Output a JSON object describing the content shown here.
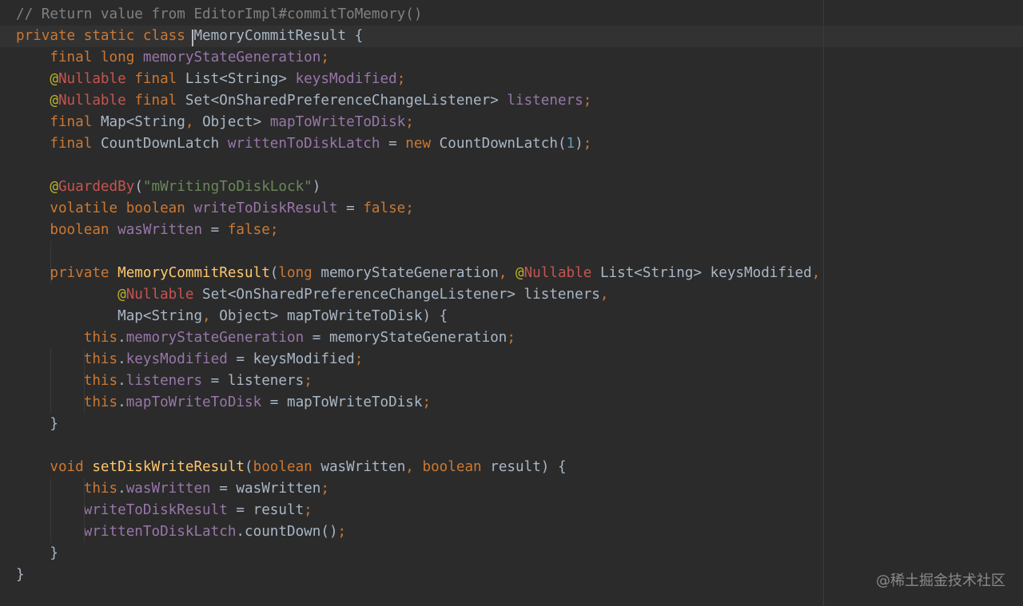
{
  "editor": {
    "language": "Java",
    "theme_colors": {
      "background": "#2b2b2b",
      "keyword": "#cc7832",
      "field": "#9876aa",
      "method": "#ffc66d",
      "string": "#6a8759",
      "number": "#6897bb",
      "comment": "#808080",
      "nullable_annotation": "#c75450",
      "plain": "#a9b7c6"
    },
    "current_line_index": 1,
    "lines": [
      [
        [
          "comment",
          "// Return value from EditorImpl#commitToMemory()"
        ]
      ],
      [
        [
          "kw",
          "private static class "
        ],
        [
          "plain",
          "MemoryCommitResult {"
        ]
      ],
      [
        [
          "plain",
          "    "
        ],
        [
          "kw",
          "final long "
        ],
        [
          "field",
          "memoryStateGeneration"
        ],
        [
          "punc",
          ";"
        ]
      ],
      [
        [
          "plain",
          "    "
        ],
        [
          "anno",
          "@"
        ],
        [
          "anno-nullable",
          "Nullable "
        ],
        [
          "kw",
          "final "
        ],
        [
          "plain",
          "List<String> "
        ],
        [
          "field",
          "keysModified"
        ],
        [
          "punc",
          ";"
        ]
      ],
      [
        [
          "plain",
          "    "
        ],
        [
          "anno",
          "@"
        ],
        [
          "anno-nullable",
          "Nullable "
        ],
        [
          "kw",
          "final "
        ],
        [
          "plain",
          "Set<OnSharedPreferenceChangeListener> "
        ],
        [
          "field",
          "listeners"
        ],
        [
          "punc",
          ";"
        ]
      ],
      [
        [
          "plain",
          "    "
        ],
        [
          "kw",
          "final "
        ],
        [
          "plain",
          "Map<String"
        ],
        [
          "punc",
          ", "
        ],
        [
          "plain",
          "Object> "
        ],
        [
          "field",
          "mapToWriteToDisk"
        ],
        [
          "punc",
          ";"
        ]
      ],
      [
        [
          "plain",
          "    "
        ],
        [
          "kw",
          "final "
        ],
        [
          "plain",
          "CountDownLatch "
        ],
        [
          "field",
          "writtenToDiskLatch "
        ],
        [
          "plain",
          "= "
        ],
        [
          "kw",
          "new "
        ],
        [
          "plain",
          "CountDownLatch("
        ],
        [
          "number",
          "1"
        ],
        [
          "plain",
          ")"
        ],
        [
          "punc",
          ";"
        ]
      ],
      [],
      [
        [
          "plain",
          "    "
        ],
        [
          "anno",
          "@"
        ],
        [
          "anno-guarded",
          "GuardedBy"
        ],
        [
          "plain",
          "("
        ],
        [
          "string",
          "\"mWritingToDiskLock\""
        ],
        [
          "plain",
          ")"
        ]
      ],
      [
        [
          "plain",
          "    "
        ],
        [
          "kw",
          "volatile boolean "
        ],
        [
          "field",
          "writeToDiskResult "
        ],
        [
          "plain",
          "= "
        ],
        [
          "kw",
          "false"
        ],
        [
          "punc",
          ";"
        ]
      ],
      [
        [
          "plain",
          "    "
        ],
        [
          "kw",
          "boolean "
        ],
        [
          "field",
          "wasWritten "
        ],
        [
          "plain",
          "= "
        ],
        [
          "kw",
          "false"
        ],
        [
          "punc",
          ";"
        ]
      ],
      [],
      [
        [
          "plain",
          "    "
        ],
        [
          "kw",
          "private "
        ],
        [
          "method",
          "MemoryCommitResult"
        ],
        [
          "plain",
          "("
        ],
        [
          "kw",
          "long "
        ],
        [
          "plain",
          "memoryStateGeneration"
        ],
        [
          "punc",
          ", "
        ],
        [
          "anno",
          "@"
        ],
        [
          "anno-nullable",
          "Nullable "
        ],
        [
          "plain",
          "List<String> keysModified"
        ],
        [
          "punc",
          ","
        ]
      ],
      [
        [
          "plain",
          "            "
        ],
        [
          "anno",
          "@"
        ],
        [
          "anno-nullable",
          "Nullable "
        ],
        [
          "plain",
          "Set<OnSharedPreferenceChangeListener> listeners"
        ],
        [
          "punc",
          ","
        ]
      ],
      [
        [
          "plain",
          "            Map<String"
        ],
        [
          "punc",
          ", "
        ],
        [
          "plain",
          "Object> mapToWriteToDisk) {"
        ]
      ],
      [
        [
          "plain",
          "        "
        ],
        [
          "kw",
          "this"
        ],
        [
          "plain",
          "."
        ],
        [
          "field",
          "memoryStateGeneration "
        ],
        [
          "plain",
          "= memoryStateGeneration"
        ],
        [
          "punc",
          ";"
        ]
      ],
      [
        [
          "plain",
          "        "
        ],
        [
          "kw",
          "this"
        ],
        [
          "plain",
          "."
        ],
        [
          "field",
          "keysModified "
        ],
        [
          "plain",
          "= keysModified"
        ],
        [
          "punc",
          ";"
        ]
      ],
      [
        [
          "plain",
          "        "
        ],
        [
          "kw",
          "this"
        ],
        [
          "plain",
          "."
        ],
        [
          "field",
          "listeners "
        ],
        [
          "plain",
          "= listeners"
        ],
        [
          "punc",
          ";"
        ]
      ],
      [
        [
          "plain",
          "        "
        ],
        [
          "kw",
          "this"
        ],
        [
          "plain",
          "."
        ],
        [
          "field",
          "mapToWriteToDisk "
        ],
        [
          "plain",
          "= mapToWriteToDisk"
        ],
        [
          "punc",
          ";"
        ]
      ],
      [
        [
          "plain",
          "    }"
        ]
      ],
      [],
      [
        [
          "plain",
          "    "
        ],
        [
          "kw",
          "void "
        ],
        [
          "method",
          "setDiskWriteResult"
        ],
        [
          "plain",
          "("
        ],
        [
          "kw",
          "boolean "
        ],
        [
          "plain",
          "wasWritten"
        ],
        [
          "punc",
          ", "
        ],
        [
          "kw",
          "boolean "
        ],
        [
          "plain",
          "result) {"
        ]
      ],
      [
        [
          "plain",
          "        "
        ],
        [
          "kw",
          "this"
        ],
        [
          "plain",
          "."
        ],
        [
          "field",
          "wasWritten "
        ],
        [
          "plain",
          "= wasWritten"
        ],
        [
          "punc",
          ";"
        ]
      ],
      [
        [
          "plain",
          "        "
        ],
        [
          "field",
          "writeToDiskResult "
        ],
        [
          "plain",
          "= result"
        ],
        [
          "punc",
          ";"
        ]
      ],
      [
        [
          "plain",
          "        "
        ],
        [
          "field",
          "writtenToDiskLatch"
        ],
        [
          "plain",
          ".countDown()"
        ],
        [
          "punc",
          ";"
        ]
      ],
      [
        [
          "plain",
          "    }"
        ]
      ],
      [
        [
          "plain",
          "}"
        ]
      ]
    ]
  },
  "watermark": {
    "text": "@稀土掘金技术社区"
  }
}
